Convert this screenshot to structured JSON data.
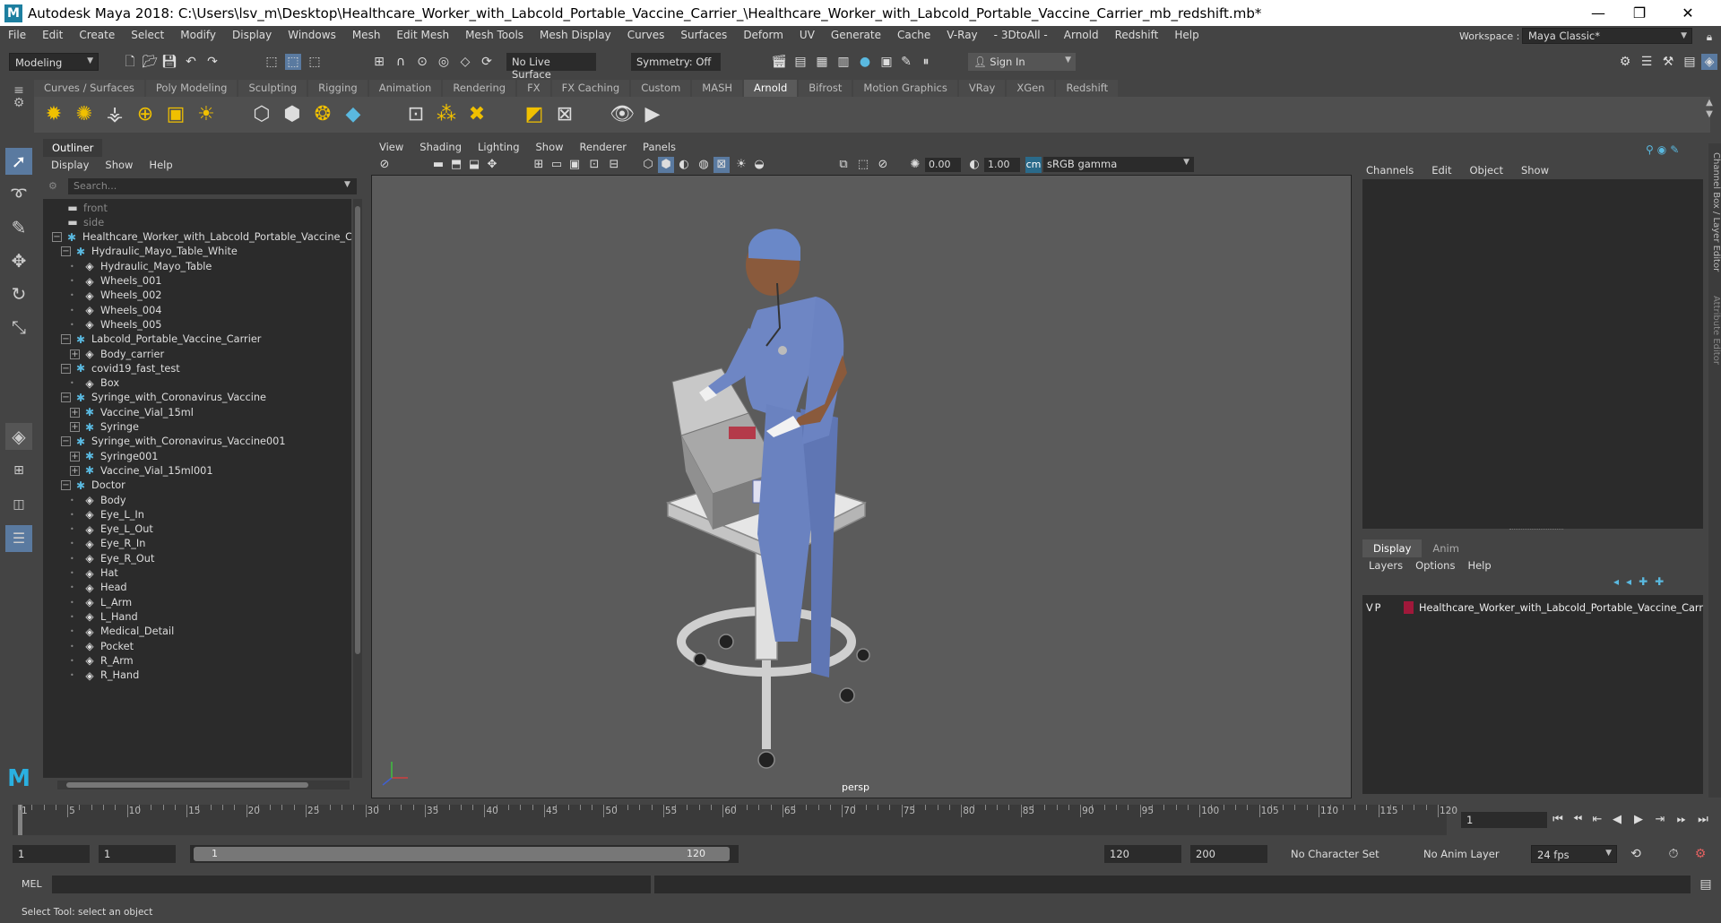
{
  "window": {
    "title": "Autodesk Maya 2018: C:\\Users\\lsv_m\\Desktop\\Healthcare_Worker_with_Labcold_Portable_Vaccine_Carrier_\\Healthcare_Worker_with_Labcold_Portable_Vaccine_Carrier_mb_redshift.mb*",
    "logo": "M"
  },
  "menubar": [
    "File",
    "Edit",
    "Create",
    "Select",
    "Modify",
    "Display",
    "Windows",
    "Mesh",
    "Edit Mesh",
    "Mesh Tools",
    "Mesh Display",
    "Curves",
    "Surfaces",
    "Deform",
    "UV",
    "Generate",
    "Cache",
    "V-Ray",
    "- 3DtoAll -",
    "Arnold",
    "Redshift",
    "Help"
  ],
  "workspace": {
    "label": "Workspace :",
    "value": "Maya Classic*"
  },
  "statusline": {
    "mode": "Modeling",
    "live_surface": "No Live Surface",
    "symmetry": "Symmetry: Off",
    "sign_in": "Sign In"
  },
  "shelf_tabs": [
    "Curves / Surfaces",
    "Poly Modeling",
    "Sculpting",
    "Rigging",
    "Animation",
    "Rendering",
    "FX",
    "FX Caching",
    "Custom",
    "MASH",
    "Arnold",
    "Bifrost",
    "Motion Graphics",
    "VRay",
    "XGen",
    "Redshift"
  ],
  "shelf_active_tab": "Arnold",
  "outliner": {
    "title": "Outliner",
    "menu": [
      "Display",
      "Show",
      "Help"
    ],
    "search_placeholder": "Search...",
    "rows": [
      {
        "label": "front",
        "icon": "camera-icon",
        "indent": 0,
        "dim": true
      },
      {
        "label": "side",
        "icon": "camera-icon",
        "indent": 0,
        "dim": true
      },
      {
        "label": "Healthcare_Worker_with_Labcold_Portable_Vaccine_Carr",
        "icon": "group-icon",
        "indent": 0,
        "exp": "−"
      },
      {
        "label": "Hydraulic_Mayo_Table_White",
        "icon": "group-icon",
        "indent": 1,
        "exp": "−"
      },
      {
        "label": "Hydraulic_Mayo_Table",
        "icon": "mesh-icon",
        "indent": 2
      },
      {
        "label": "Wheels_001",
        "icon": "mesh-icon",
        "indent": 2
      },
      {
        "label": "Wheels_002",
        "icon": "mesh-icon",
        "indent": 2
      },
      {
        "label": "Wheels_004",
        "icon": "mesh-icon",
        "indent": 2
      },
      {
        "label": "Wheels_005",
        "icon": "mesh-icon",
        "indent": 2
      },
      {
        "label": "Labcold_Portable_Vaccine_Carrier",
        "icon": "group-icon",
        "indent": 1,
        "exp": "−"
      },
      {
        "label": "Body_carrier",
        "icon": "mesh-icon",
        "indent": 2,
        "exp": "+"
      },
      {
        "label": "covid19_fast_test",
        "icon": "group-icon",
        "indent": 1,
        "exp": "−"
      },
      {
        "label": "Box",
        "icon": "mesh-icon",
        "indent": 2
      },
      {
        "label": "Syringe_with_Coronavirus_Vaccine",
        "icon": "group-icon",
        "indent": 1,
        "exp": "−"
      },
      {
        "label": "Vaccine_Vial_15ml",
        "icon": "group-icon",
        "indent": 2,
        "exp": "+"
      },
      {
        "label": "Syringe",
        "icon": "group-icon",
        "indent": 2,
        "exp": "+"
      },
      {
        "label": "Syringe_with_Coronavirus_Vaccine001",
        "icon": "group-icon",
        "indent": 1,
        "exp": "−"
      },
      {
        "label": "Syringe001",
        "icon": "group-icon",
        "indent": 2,
        "exp": "+"
      },
      {
        "label": "Vaccine_Vial_15ml001",
        "icon": "group-icon",
        "indent": 2,
        "exp": "+"
      },
      {
        "label": "Doctor",
        "icon": "group-icon",
        "indent": 1,
        "exp": "−"
      },
      {
        "label": "Body",
        "icon": "mesh-icon",
        "indent": 2
      },
      {
        "label": "Eye_L_In",
        "icon": "mesh-icon",
        "indent": 2
      },
      {
        "label": "Eye_L_Out",
        "icon": "mesh-icon",
        "indent": 2
      },
      {
        "label": "Eye_R_In",
        "icon": "mesh-icon",
        "indent": 2
      },
      {
        "label": "Eye_R_Out",
        "icon": "mesh-icon",
        "indent": 2
      },
      {
        "label": "Hat",
        "icon": "mesh-icon",
        "indent": 2
      },
      {
        "label": "Head",
        "icon": "mesh-icon",
        "indent": 2
      },
      {
        "label": "L_Arm",
        "icon": "mesh-icon",
        "indent": 2
      },
      {
        "label": "L_Hand",
        "icon": "mesh-icon",
        "indent": 2
      },
      {
        "label": "Medical_Detail",
        "icon": "mesh-icon",
        "indent": 2
      },
      {
        "label": "Pocket",
        "icon": "mesh-icon",
        "indent": 2
      },
      {
        "label": "R_Arm",
        "icon": "mesh-icon",
        "indent": 2
      },
      {
        "label": "R_Hand",
        "icon": "mesh-icon",
        "indent": 2
      }
    ]
  },
  "viewport": {
    "menu": [
      "View",
      "Shading",
      "Lighting",
      "Show",
      "Renderer",
      "Panels"
    ],
    "exposure": "0.00",
    "gamma": "1.00",
    "color_space": "sRGB gamma",
    "camera_label": "persp"
  },
  "channelbox": {
    "menu": [
      "Channels",
      "Edit",
      "Object",
      "Show"
    ],
    "tabs": [
      "Display",
      "Anim"
    ],
    "active_tab": "Display",
    "layer_menu": [
      "Layers",
      "Options",
      "Help"
    ],
    "layer": {
      "v": "V",
      "p": "P",
      "name": "Healthcare_Worker_with_Labcold_Portable_Vaccine_Carr",
      "color": "#a0183a"
    },
    "side_labels": [
      "Channel Box / Layer Editor",
      "Attribute Editor"
    ]
  },
  "timeslider": {
    "ticks": [
      1,
      5,
      10,
      15,
      20,
      25,
      30,
      35,
      40,
      45,
      50,
      55,
      60,
      65,
      70,
      75,
      80,
      85,
      90,
      95,
      100,
      105,
      110,
      115,
      120
    ],
    "current_frame": "1"
  },
  "range": {
    "start": "1",
    "playback_start": "1",
    "range_start_label": "1",
    "range_end_label": "120",
    "playback_end": "120",
    "end": "200",
    "character_set": "No Character Set",
    "anim_layer": "No Anim Layer",
    "fps": "24 fps"
  },
  "cmdline": {
    "label": "MEL"
  },
  "helpline": "Select Tool: select an object"
}
